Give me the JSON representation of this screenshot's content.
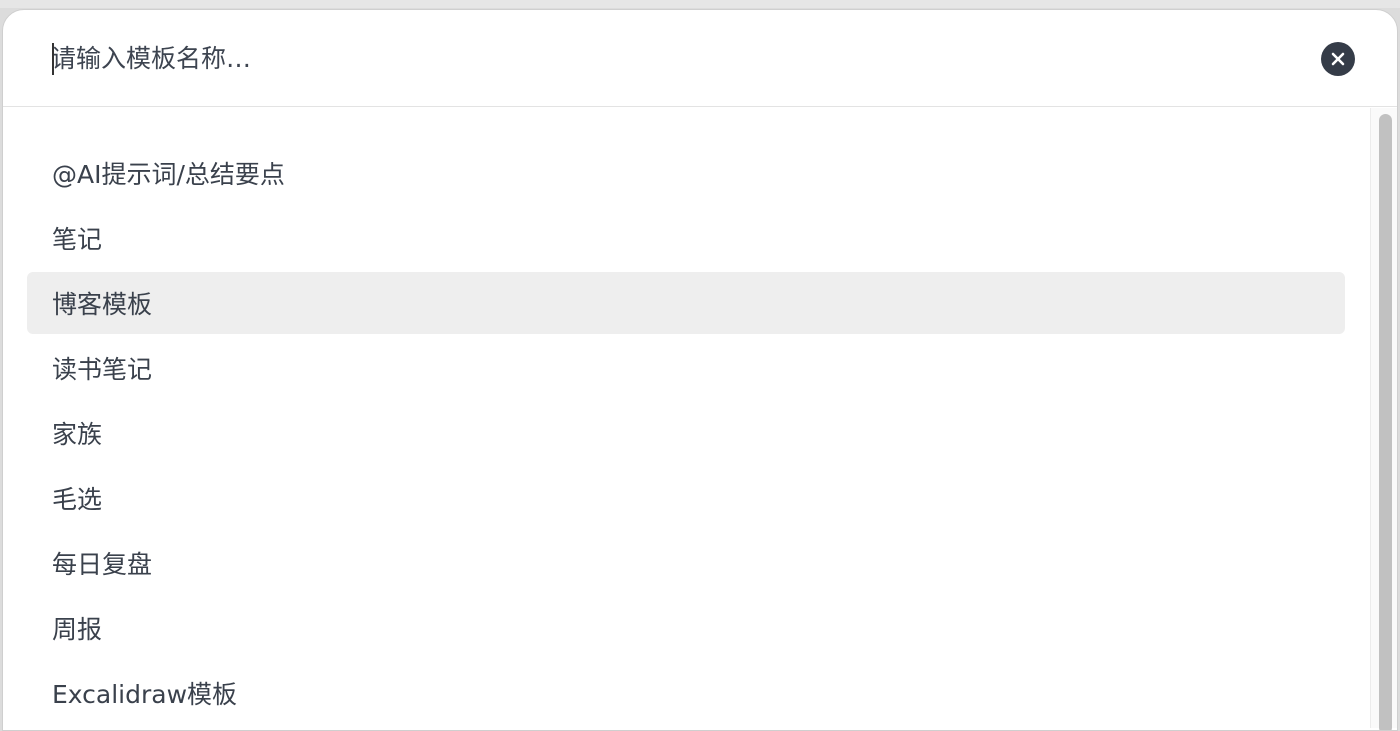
{
  "search": {
    "placeholder": "请输入模板名称…"
  },
  "icons": {
    "close": "close-icon"
  },
  "templates": [
    {
      "label": "@AI提示词/总结要点"
    },
    {
      "label": "笔记"
    },
    {
      "label": "博客模板",
      "highlighted": true
    },
    {
      "label": "读书笔记"
    },
    {
      "label": "家族"
    },
    {
      "label": "毛选"
    },
    {
      "label": "每日复盘"
    },
    {
      "label": "周报"
    },
    {
      "label": "Excalidraw模板"
    }
  ],
  "colors": {
    "text": "#3a414c",
    "highlight": "#eeeeee",
    "close_button": "#353c48"
  }
}
